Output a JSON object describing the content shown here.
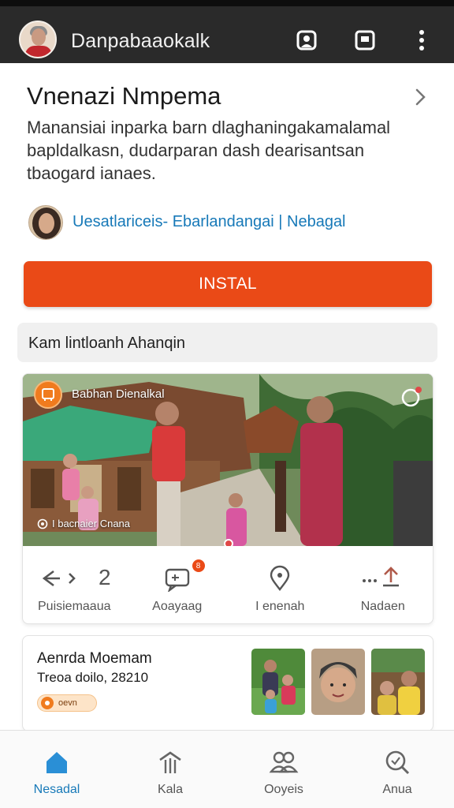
{
  "app": {
    "title": "Danpabaaokalk"
  },
  "header": {
    "title": "Vnenazi Nmpema",
    "description": "Manansiai inparka barn dlaghaningakamalamal bapldalkasn, dudarparan dash dearisantsan tbaogard ianaes.",
    "owner": "Uesatlariceis- Ebarlandangai | Nebagal",
    "install_label": "INSTAL"
  },
  "section": {
    "label": "Kam lintloanh Ahanqin"
  },
  "post": {
    "source": "Babhan Dienalkal",
    "caption": "I bacnaier Cnana",
    "actions": [
      {
        "label": "Puisiemaaua",
        "count": "2",
        "icon": "share-icon"
      },
      {
        "label": "Aoayaag",
        "badge": "8",
        "icon": "chat-icon"
      },
      {
        "label": "I enenah",
        "icon": "location-icon"
      },
      {
        "label": "Nadaen",
        "icon": "upload-icon"
      }
    ]
  },
  "event": {
    "title": "Aenrda Moemam",
    "subtitle": "Treoa doilo, 28210",
    "badge": "oevn"
  },
  "bottom_nav": [
    {
      "label": "Nesadal",
      "icon": "home-icon",
      "active": true
    },
    {
      "label": "Kala",
      "icon": "tower-icon",
      "active": false
    },
    {
      "label": "Ooyeis",
      "icon": "people-icon",
      "active": false
    },
    {
      "label": "Anua",
      "icon": "search-icon",
      "active": false
    }
  ],
  "colors": {
    "accent": "#ea4a17",
    "link": "#1779b8",
    "topbar": "#2a2a2a"
  }
}
